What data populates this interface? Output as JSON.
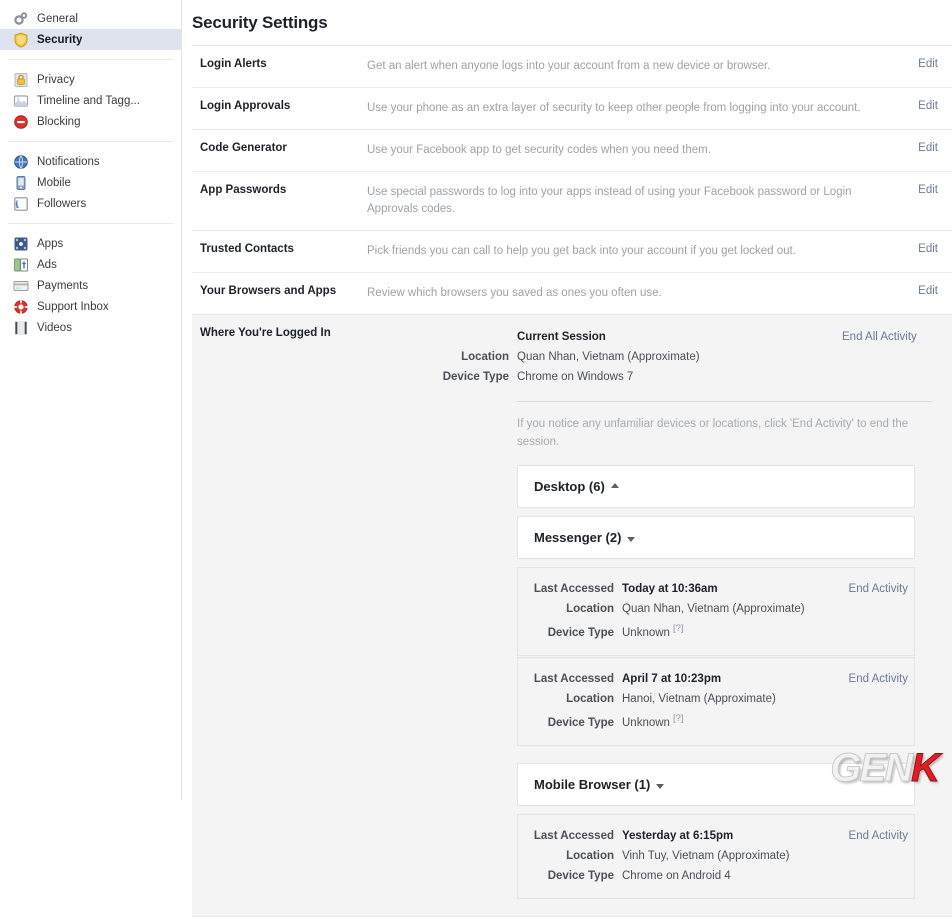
{
  "sidebar": {
    "groups": [
      {
        "items": [
          {
            "label": "General",
            "icon": "gears-icon",
            "selected": false
          },
          {
            "label": "Security",
            "icon": "shield-icon",
            "selected": true
          }
        ]
      },
      {
        "items": [
          {
            "label": "Privacy",
            "icon": "lock-icon",
            "selected": false
          },
          {
            "label": "Timeline and Tagg...",
            "icon": "timeline-icon",
            "selected": false
          },
          {
            "label": "Blocking",
            "icon": "block-icon",
            "selected": false
          }
        ]
      },
      {
        "items": [
          {
            "label": "Notifications",
            "icon": "globe-icon",
            "selected": false
          },
          {
            "label": "Mobile",
            "icon": "phone-icon",
            "selected": false
          },
          {
            "label": "Followers",
            "icon": "rss-icon",
            "selected": false
          }
        ]
      },
      {
        "items": [
          {
            "label": "Apps",
            "icon": "apps-icon",
            "selected": false
          },
          {
            "label": "Ads",
            "icon": "ads-icon",
            "selected": false
          },
          {
            "label": "Payments",
            "icon": "card-icon",
            "selected": false
          },
          {
            "label": "Support Inbox",
            "icon": "lifering-icon",
            "selected": false
          },
          {
            "label": "Videos",
            "icon": "film-icon",
            "selected": false
          }
        ]
      }
    ]
  },
  "main": {
    "title": "Security Settings",
    "edit_label": "Edit",
    "settings_rows": [
      {
        "label": "Login Alerts",
        "desc": "Get an alert when anyone logs into your account from a new device or browser."
      },
      {
        "label": "Login Approvals",
        "desc": "Use your phone as an extra layer of security to keep other people from logging into your account."
      },
      {
        "label": "Code Generator",
        "desc": "Use your Facebook app to get security codes when you need them."
      },
      {
        "label": "App Passwords",
        "desc": "Use special passwords to log into your apps instead of using your Facebook password or Login Approvals codes."
      },
      {
        "label": "Trusted Contacts",
        "desc": "Pick friends you can call to help you get back into your account if you get locked out."
      },
      {
        "label": "Your Browsers and Apps",
        "desc": "Review which browsers you saved as ones you often use."
      }
    ],
    "logged_in": {
      "title": "Where You're Logged In",
      "current_session": {
        "heading": "Current Session",
        "end_all_label": "End All Activity",
        "location_key": "Location",
        "location_value": "Quan Nhan, Vietnam (Approximate)",
        "device_key": "Device Type",
        "device_value": "Chrome on Windows 7"
      },
      "notice": "If you notice any unfamiliar devices or locations, click 'End Activity' to end the session.",
      "end_activity_label": "End Activity",
      "keys": {
        "last_accessed": "Last Accessed",
        "location": "Location",
        "device_type": "Device Type"
      },
      "groups": [
        {
          "name": "Desktop (6)",
          "caret": "up",
          "expanded": false,
          "sessions": []
        },
        {
          "name": "Messenger (2)",
          "caret": "down",
          "expanded": true,
          "sessions": [
            {
              "last_accessed": "Today at 10:36am",
              "location": "Quan Nhan, Vietnam (Approximate)",
              "device_type": "Unknown",
              "device_hint": "[?]"
            },
            {
              "last_accessed": "April 7 at 10:23pm",
              "location": "Hanoi, Vietnam (Approximate)",
              "device_type": "Unknown",
              "device_hint": "[?]"
            }
          ]
        },
        {
          "name": "Mobile Browser (1)",
          "caret": "down",
          "expanded": true,
          "sessions": [
            {
              "last_accessed": "Yesterday at 6:15pm",
              "location": "Vinh Tuy, Vietnam (Approximate)",
              "device_type": "Chrome on Android 4",
              "device_hint": ""
            }
          ]
        }
      ]
    }
  },
  "watermark": {
    "part1": "GEN",
    "part2": "K"
  },
  "colors": {
    "selected_nav": "#dfe3ee",
    "link": "#6c7a94",
    "muted_text": "#9da2a8",
    "panel_bg": "#f4f4f4",
    "accent_red": "#e01e26"
  }
}
